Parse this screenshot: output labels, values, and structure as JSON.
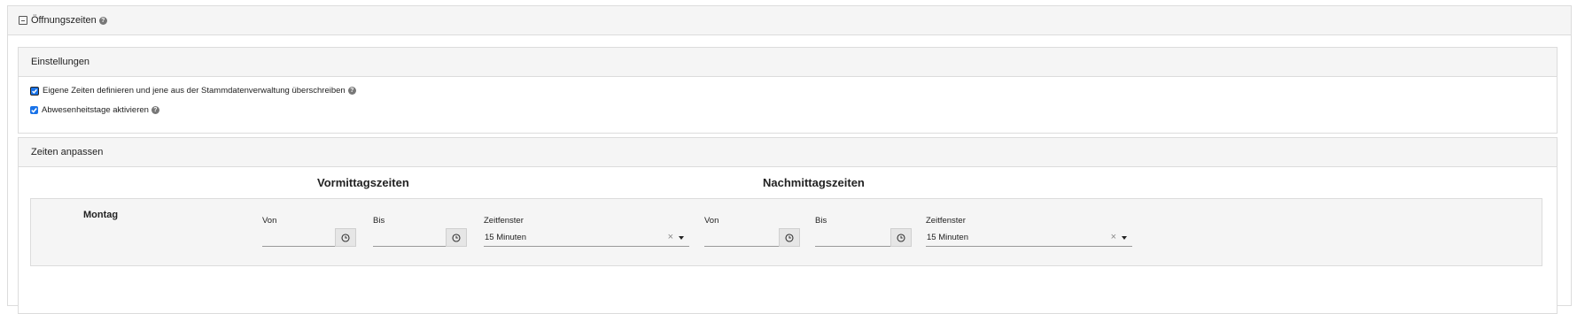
{
  "section": {
    "title": "Öffnungszeiten"
  },
  "settings": {
    "title": "Einstellungen",
    "option1_label": "Eigene Zeiten definieren und jene aus der Stammdatenverwaltung überschreiben",
    "option1_checked": true,
    "option2_label": "Abwesenheitstage aktivieren",
    "option2_checked": true
  },
  "times": {
    "title": "Zeiten anpassen",
    "morning_title": "Vormittagszeiten",
    "afternoon_title": "Nachmittagszeiten",
    "day": "Montag",
    "morning": {
      "from_label": "Von",
      "from_value": "",
      "to_label": "Bis",
      "to_value": "",
      "window_label": "Zeitfenster",
      "window_value": "15 Minuten",
      "clear_icon": "×"
    },
    "afternoon": {
      "from_label": "Von",
      "from_value": "",
      "to_label": "Bis",
      "to_value": "",
      "window_label": "Zeitfenster",
      "window_value": "15 Minuten",
      "clear_icon": "×"
    }
  },
  "icons": {
    "help": "?",
    "collapse": "minus-square-icon",
    "clock": "clock-icon",
    "dropdown": "caret-down-icon"
  },
  "colors": {
    "checkbox": "#1a73e8",
    "header_bg": "#f5f5f5",
    "border": "#dcdcdc"
  }
}
